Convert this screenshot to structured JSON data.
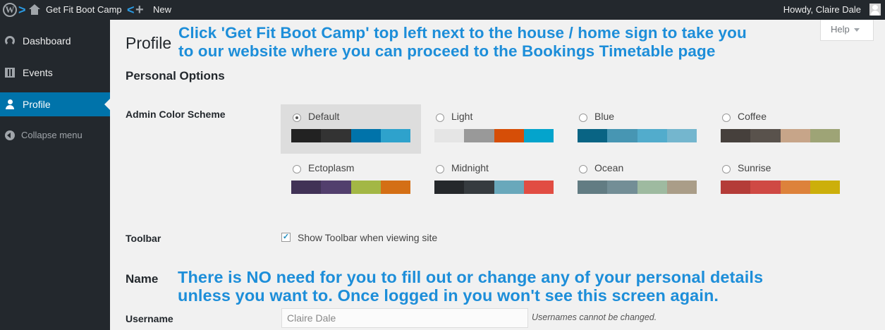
{
  "adminbar": {
    "site_name": "Get Fit Boot Camp",
    "new_label": "New",
    "howdy": "Howdy, Claire Dale",
    "annotation_arrow_1": ">",
    "annotation_arrow_2": "<",
    "wp_logo_glyph": "W",
    "plus_glyph": "+"
  },
  "sidebar": {
    "items": [
      {
        "label": "Dashboard",
        "icon": "dashboard-icon"
      },
      {
        "label": "Events",
        "icon": "calendar-icon"
      },
      {
        "label": "Profile",
        "icon": "user-icon",
        "active": true
      },
      {
        "label": "Collapse menu",
        "icon": "collapse-icon"
      }
    ]
  },
  "help_tab": "Help",
  "page": {
    "title": "Profile",
    "section_personal": "Personal Options",
    "color_scheme_label": "Admin Color Scheme",
    "toolbar_label": "Toolbar",
    "toolbar_checkbox": "Show Toolbar when viewing site",
    "toolbar_checked": true,
    "name_heading": "Name",
    "username_label": "Username",
    "username_value": "Claire Dale",
    "username_note": "Usernames cannot be changed."
  },
  "color_schemes": [
    {
      "name": "Default",
      "selected": true,
      "colors": [
        "#222222",
        "#333333",
        "#0073aa",
        "#2ea2cc"
      ]
    },
    {
      "name": "Light",
      "selected": false,
      "colors": [
        "#e5e5e5",
        "#999999",
        "#d64e07",
        "#04a4cc"
      ]
    },
    {
      "name": "Blue",
      "selected": false,
      "colors": [
        "#096484",
        "#4796b3",
        "#52accc",
        "#74b6ce"
      ]
    },
    {
      "name": "Coffee",
      "selected": false,
      "colors": [
        "#46403c",
        "#59524c",
        "#c7a589",
        "#9ea476"
      ]
    },
    {
      "name": "Ectoplasm",
      "selected": false,
      "colors": [
        "#413256",
        "#523f6d",
        "#a3b745",
        "#d46f15"
      ]
    },
    {
      "name": "Midnight",
      "selected": false,
      "colors": [
        "#25282b",
        "#363b3f",
        "#69a8bb",
        "#e14d43"
      ]
    },
    {
      "name": "Ocean",
      "selected": false,
      "colors": [
        "#627c83",
        "#738e96",
        "#9ebaa0",
        "#aa9d88"
      ]
    },
    {
      "name": "Sunrise",
      "selected": false,
      "colors": [
        "#b43c38",
        "#cf4944",
        "#dd823b",
        "#ccaf0b"
      ]
    }
  ],
  "annotations": {
    "top_line1": "Click 'Get Fit Boot Camp' top left next to the house / home sign to take you",
    "top_line2": "to our website where you can proceed to the Bookings Timetable page",
    "bottom_line1": "There is NO need for you to fill out or change any of your personal details",
    "bottom_line2": "unless you want to. Once logged in you won't see this screen again."
  }
}
